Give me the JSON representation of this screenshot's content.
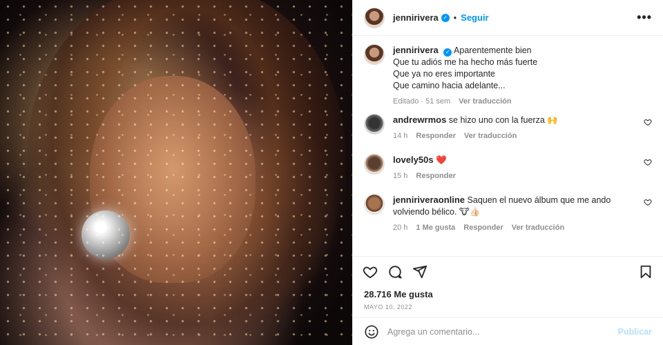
{
  "post": {
    "username": "jennirivera",
    "dot": "•",
    "follow_label": "Seguir",
    "more_label": "•••",
    "caption_lines": [
      "Aparentemente bien",
      "Que tu adiós me ha hecho más fuerte",
      "Que ya no eres importante",
      "Que camino hacia adelante..."
    ],
    "caption_meta": {
      "edited": "Editado · 51 sem",
      "translate": "Ver traducción"
    },
    "comments": [
      {
        "user": "andrewrmos",
        "text": "se hizo uno con la fuerza 🙌",
        "time": "14 h",
        "reply": "Responder",
        "translate": "Ver traducción"
      },
      {
        "user": "lovely50s",
        "text": "❤️",
        "time": "15 h",
        "reply": "Responder"
      },
      {
        "user": "jenniriveraonline",
        "text": "Saquen el nuevo álbum que me ando volviendo bélico. 🐮👍🏻",
        "time": "20 h",
        "likes": "1 Me gusta",
        "reply": "Responder",
        "translate": "Ver traducción"
      }
    ],
    "like_count": "28.716 Me gusta",
    "date": "MAYO 10, 2022",
    "comment_placeholder": "Agrega un comentario...",
    "publish_label": "Publicar"
  },
  "colors": {
    "accent": "#0095f6",
    "muted": "#8e8e8e",
    "text": "#262626",
    "publish_disabled": "#b2dffc"
  },
  "icons": [
    "heart-icon",
    "comment-icon",
    "share-icon",
    "bookmark-icon",
    "emoji-icon",
    "verified-icon",
    "more-icon"
  ]
}
